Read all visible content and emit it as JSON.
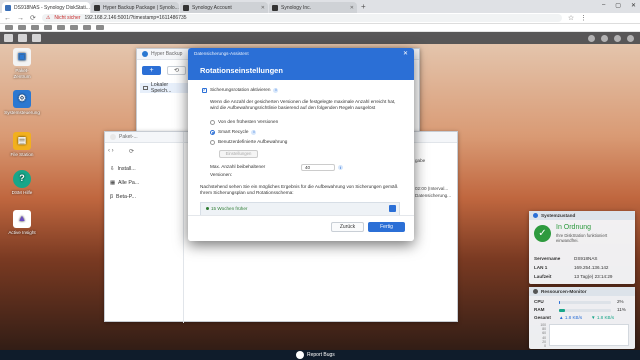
{
  "browser": {
    "tabs": [
      {
        "title": "DS918NAS - Synology DiskStati..."
      },
      {
        "title": "Hyper Backup Package | Synolo..."
      },
      {
        "title": "Synology Account"
      },
      {
        "title": "Synology Inc."
      }
    ],
    "security_label": "Nicht sicher",
    "url": "192.168.2.146:5001/?timestamp=1611486735"
  },
  "desktop_icons": [
    {
      "label": "Paket-\nZentrum",
      "color": "#f3f3f3",
      "glyph": "▣"
    },
    {
      "label": "Systemsteuerung",
      "color": "#2b78d1",
      "glyph": "⚙"
    },
    {
      "label": "File Station",
      "color": "#f2b01e",
      "glyph": "▤"
    },
    {
      "label": "DSM Hilfe",
      "color": "#18a689",
      "glyph": "?"
    },
    {
      "label": "Active Insight",
      "color": "#ffffff",
      "glyph": "▲"
    }
  ],
  "hyper_backup": {
    "title": "Hyper Backup",
    "sidebar_item": "Lokaler Speich..."
  },
  "pkg_window": {
    "title": "Paket-...",
    "items": [
      "Install...",
      "Alle Pa...",
      "Beta-P..."
    ],
    "right_texts": [
      "gabe",
      "02:00 (Interval...",
      "Datensicherung..."
    ]
  },
  "dialog": {
    "wizard_title": "Datensicherungs-Assistent",
    "heading": "Rotationseinstellungen",
    "enable_rotation": "Sicherungsrotation aktivieren",
    "description": "Wenn die Anzahl der gesicherten Versionen die festgelegte maximale Anzahl erreicht hat, wird die Aufbewahrungsrichtlinie basierend auf den folgenden Regeln ausgelöst",
    "opt_earliest": "Von den frühesten Versionen",
    "opt_smart": "Smart Recycle",
    "opt_custom": "Benutzerdefinierte Aufbewahrung",
    "settings_button": "Einstellungen",
    "max_versions_label": "Max. Anzahl beibehaltener",
    "versions_label": "Versionen:",
    "max_versions_value": "40",
    "timeline_note": "Nachstehend sehen Sie ein mögliches Ergebnis für die Aufbewahrung von Sicherungen gemäß Ihrem Sicherungsplan und Rotationsschema:",
    "timeline_label": "15 Wochen früher",
    "back_button": "Zurück",
    "done_button": "Fertig"
  },
  "system_widget": {
    "title": "Systemzustand",
    "status": "In Ordnung",
    "status_desc": "Ihre DiskStation funktioniert einwandfrei.",
    "rows": [
      {
        "key": "Servername",
        "value": "DS918NAS"
      },
      {
        "key": "LAN 1",
        "value": "169.254.136.142"
      },
      {
        "key": "Laufzeit",
        "value": "13 Tag(e) 23:14:29"
      }
    ]
  },
  "resource_widget": {
    "title": "Ressourcen-Monitor",
    "cpu_label": "CPU",
    "cpu_value": "2%",
    "cpu_fraction": 0.02,
    "ram_label": "RAM",
    "ram_value": "11%",
    "ram_fraction": 0.11,
    "total_label": "Gesamt",
    "up_rate": "1.8 KB/s",
    "down_rate": "1.8 KB/s",
    "y_ticks": [
      "100",
      "80",
      "60",
      "40",
      "20",
      "0"
    ]
  },
  "report_bugs": "Report Bugs",
  "colors": {
    "accent": "#2b6fd6",
    "ok": "#2e9a3e"
  }
}
